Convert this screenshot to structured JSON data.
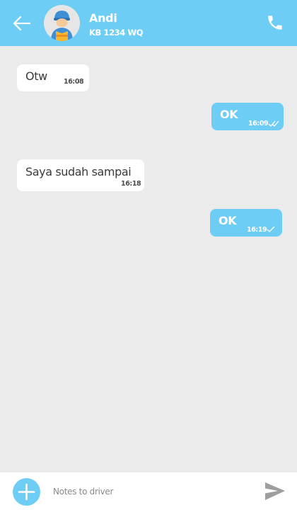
{
  "header": {
    "driver_name": "Andi",
    "plate_number": "KB 1234 WQ",
    "back_icon": "arrow-left-icon",
    "call_icon": "phone-icon",
    "avatar_icon": "driver-avatar"
  },
  "messages": [
    {
      "direction": "in",
      "text": "Otw",
      "time": "16:08",
      "status": ""
    },
    {
      "direction": "out",
      "text": "OK",
      "time": "16:09",
      "status": "read"
    },
    {
      "direction": "in",
      "text": "Saya sudah sampai",
      "time": "16:18",
      "status": ""
    },
    {
      "direction": "out",
      "text": "OK",
      "time": "16:19",
      "status": "sent"
    }
  ],
  "footer": {
    "note_placeholder": "Notes to driver",
    "note_value": "",
    "add_icon": "plus-icon",
    "send_icon": "send-icon"
  },
  "colors": {
    "accent": "#6ecdf5",
    "background": "#ebebeb",
    "incoming_bubble": "#ffffff"
  }
}
